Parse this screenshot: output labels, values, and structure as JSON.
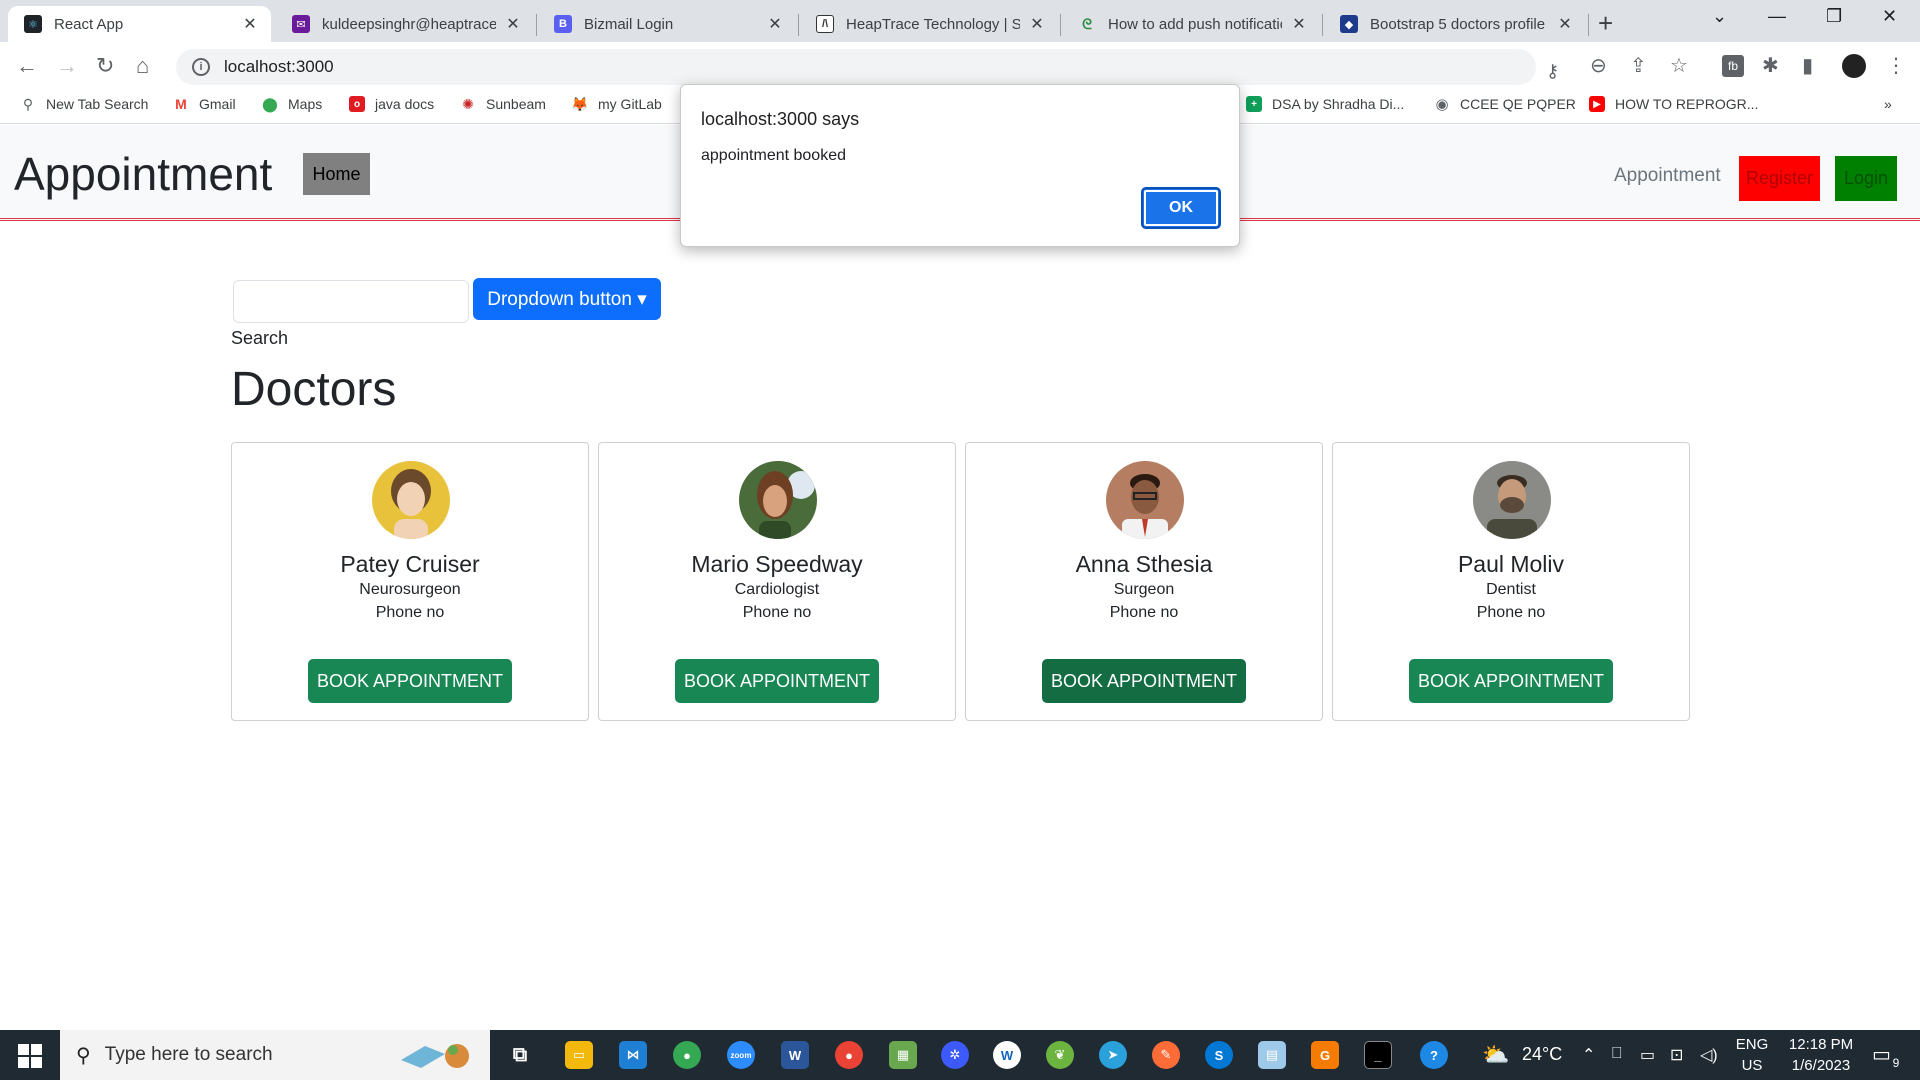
{
  "browser": {
    "tabs": [
      {
        "title": "React App",
        "active": true,
        "icon": "react-icon",
        "color": "#20232a"
      },
      {
        "title": "kuldeepsinghr@heaptrace.c",
        "active": false,
        "icon": "mail-icon",
        "color": "#6a1b9a"
      },
      {
        "title": "Bizmail Login",
        "active": false,
        "icon": "bizmail-icon",
        "color": "#5a5ff0"
      },
      {
        "title": "HeapTrace Technology | Sm",
        "active": false,
        "icon": "heaptrace-icon",
        "color": "#ffffff"
      },
      {
        "title": "How to add push notificatio",
        "active": false,
        "icon": "gfg-icon",
        "color": "#2f8d46"
      },
      {
        "title": "Bootstrap 5 doctors profile",
        "active": false,
        "icon": "bootstrap-icon",
        "color": "#1e3a8a"
      }
    ],
    "url": "localhost:3000",
    "bookmarks": [
      {
        "label": "New Tab Search",
        "icon": "search-icon",
        "color": "#5f6368"
      },
      {
        "label": "Gmail",
        "icon": "gmail-icon",
        "color": "#ea4335"
      },
      {
        "label": "Maps",
        "icon": "maps-icon",
        "color": "#34a853"
      },
      {
        "label": "java docs",
        "icon": "oracle-icon",
        "color": "#e01b22"
      },
      {
        "label": "Sunbeam",
        "icon": "sunbeam-icon",
        "color": "#c62828"
      },
      {
        "label": "my GitLab",
        "icon": "gitlab-icon",
        "color": "#fc6d26"
      },
      {
        "label": "DSA by Shradha Di...",
        "icon": "sheets-icon",
        "color": "#0f9d58"
      },
      {
        "label": "CCEE QE PQPER",
        "icon": "globe-icon",
        "color": "#5f6368"
      },
      {
        "label": "HOW TO REPROGR...",
        "icon": "youtube-icon",
        "color": "#ff0000"
      }
    ]
  },
  "app": {
    "brand": "Appointment",
    "home_label": "Home",
    "nav_link": "Appointment",
    "register_label": "Register",
    "login_label": "Login",
    "search_label": "Search",
    "search_value": "",
    "dropdown_label": "Dropdown button ▾",
    "section_title": "Doctors",
    "doctors": [
      {
        "name": "Patey Cruiser",
        "specialty": "Neurosurgeon",
        "phone": "Phone no",
        "button": "BOOK APPOINTMENT",
        "avatar_bg": "#e8c23a",
        "avatar_fg": "#f2d2b4"
      },
      {
        "name": "Mario Speedway",
        "specialty": "Cardiologist",
        "phone": "Phone no",
        "button": "BOOK APPOINTMENT",
        "avatar_bg": "#4a6b3a",
        "avatar_fg": "#d9a27f"
      },
      {
        "name": "Anna Sthesia",
        "specialty": "Surgeon",
        "phone": "Phone no",
        "button": "BOOK APPOINTMENT",
        "avatar_bg": "#b57e63",
        "avatar_fg": "#7a4b34"
      },
      {
        "name": "Paul Moliv",
        "specialty": "Dentist",
        "phone": "Phone no",
        "button": "BOOK APPOINTMENT",
        "avatar_bg": "#8a8a86",
        "avatar_fg": "#5b4a3c"
      }
    ],
    "colors": {
      "primary": "#0d6efd",
      "success": "#198754",
      "register": "#ff0000",
      "login": "#008000",
      "home": "#808080"
    }
  },
  "alert": {
    "title": "localhost:3000 says",
    "message": "appointment booked",
    "ok_label": "OK"
  },
  "taskbar": {
    "search_placeholder": "Type here to search",
    "weather": "24°C",
    "lang_top": "ENG",
    "lang_bottom": "US",
    "time": "12:18 PM",
    "date": "1/6/2023",
    "notifications": "9"
  }
}
